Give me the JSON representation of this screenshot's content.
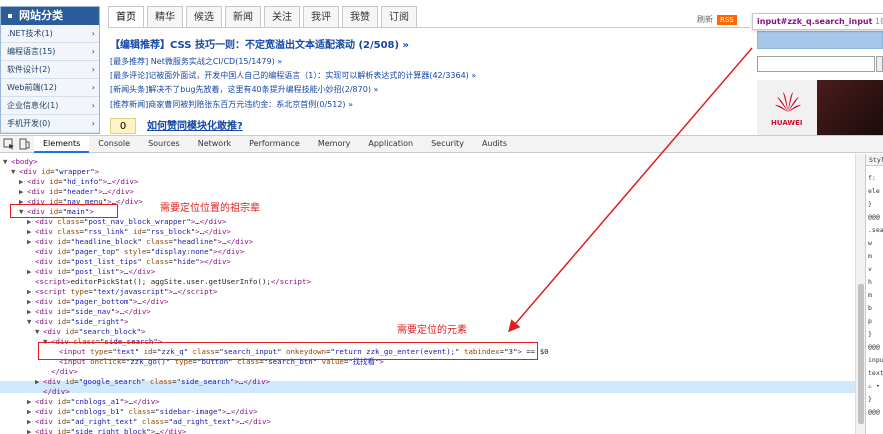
{
  "site": {
    "nav_header": "网站分类",
    "nav_items": [
      ".NET技术(1)",
      "编程语言(15)",
      "软件设计(2)",
      "Web前端(12)",
      "企业信息化(1)",
      "手机开发(0)"
    ],
    "tabs": [
      "首页",
      "精华",
      "候选",
      "新闻",
      "关注",
      "我评",
      "我赞",
      "订阅"
    ],
    "refresh": "刷新",
    "rss": "RSS",
    "headline": "【编辑推荐】CSS 技巧一则：不定宽溢出文本适配滚动 (2/508) »",
    "posts": [
      "[最多推荐] Net微服务实战之CI/CD(15/1479) »",
      "[最多评论]记被面外面试，开发中国人自己的编程语言（1）：实现可以解析表达式的计算器(42/3364) »",
      "[新闻头条]解决不了bug先放着，这里有40条提升编程技能小妙招(2/870) »",
      "[推荐新闻]商家曹同被判赔张东百万元违约金：系北京首例(0/512) »"
    ],
    "zero_badge": "0",
    "question": "如何赞同模块化敢推?",
    "tooltip": {
      "selector": "input#zzk_q.search_input",
      "size": "186 × 2"
    },
    "huawei": "HUAWEI"
  },
  "devtools": {
    "tabs": [
      "Elements",
      "Console",
      "Sources",
      "Network",
      "Performance",
      "Memory",
      "Application",
      "Security",
      "Audits"
    ],
    "styles_tab": "Styl",
    "styles_lines": [
      "f:",
      "ele",
      "}",
      "@@@",
      ".sea",
      "w",
      "m",
      "v",
      "h",
      "m",
      "b",
      "p",
      "}",
      "@@@",
      "inpu",
      "text",
      "⚠ •",
      "}",
      "@@@"
    ]
  },
  "dom": [
    {
      "d": 0,
      "tri": "",
      "html": "<span class='t'>&lt;html&gt;</span>"
    },
    {
      "d": 0,
      "tri": "▼",
      "html": "<span class='t'>&lt;body&gt;</span>"
    },
    {
      "d": 1,
      "tri": "▼",
      "html": "<span class='t'>&lt;div</span> <span class='an'>id</span>=\"<span class='av'>wrapper</span>\"<span class='t'>&gt;</span>"
    },
    {
      "d": 2,
      "tri": "▶",
      "html": "<span class='t'>&lt;div</span> <span class='an'>id</span>=\"<span class='av'>hd_info</span>\"<span class='t'>&gt;</span>…<span class='t'>&lt;/div&gt;</span>"
    },
    {
      "d": 2,
      "tri": "▶",
      "html": "<span class='t'>&lt;div</span> <span class='an'>id</span>=\"<span class='av'>header</span>\"<span class='t'>&gt;</span>…<span class='t'>&lt;/div&gt;</span>"
    },
    {
      "d": 2,
      "tri": "▶",
      "html": "<span class='t'>&lt;div</span> <span class='an'>id</span>=\"<span class='av'>nav_menu</span>\"<span class='t'>&gt;</span>…<span class='t'>&lt;/div&gt;</span>"
    },
    {
      "d": 2,
      "tri": "▼",
      "html": "<span class='t'>&lt;div</span> <span class='an'>id</span>=\"<span class='av'>main</span>\"<span class='t'>&gt;</span>"
    },
    {
      "d": 3,
      "tri": "▶",
      "html": "<span class='t'>&lt;div</span> <span class='an'>class</span>=\"<span class='av'>post_nav_block_wrapper</span>\"<span class='t'>&gt;</span>…<span class='t'>&lt;/div&gt;</span>"
    },
    {
      "d": 3,
      "tri": "▶",
      "html": "<span class='t'>&lt;div</span> <span class='an'>class</span>=\"<span class='av'>rss_link</span>\" <span class='an'>id</span>=\"<span class='av'>rss_block</span>\"<span class='t'>&gt;</span>…<span class='t'>&lt;/div&gt;</span>"
    },
    {
      "d": 3,
      "tri": "▶",
      "html": "<span class='t'>&lt;div</span> <span class='an'>id</span>=\"<span class='av'>headline_block</span>\" <span class='an'>class</span>=\"<span class='av'>headline</span>\"<span class='t'>&gt;</span>…<span class='t'>&lt;/div&gt;</span>"
    },
    {
      "d": 3,
      "tri": "",
      "html": "<span class='t'>&lt;div</span> <span class='an'>id</span>=\"<span class='av'>pager_top</span>\" <span class='an'>style</span>=\"<span class='av'>display:none</span>\"<span class='t'>&gt;&lt;/div&gt;</span>"
    },
    {
      "d": 3,
      "tri": "",
      "html": "<span class='t'>&lt;div</span> <span class='an'>id</span>=\"<span class='av'>post_list_tips</span>\" <span class='an'>class</span>=\"<span class='av'>hide</span>\"<span class='t'>&gt;&lt;/div&gt;</span>"
    },
    {
      "d": 3,
      "tri": "▶",
      "html": "<span class='t'>&lt;div</span> <span class='an'>id</span>=\"<span class='av'>post_list</span>\"<span class='t'>&gt;</span>…<span class='t'>&lt;/div&gt;</span>"
    },
    {
      "d": 3,
      "tri": "",
      "html": "<span class='t'>&lt;script&gt;</span><span class='tx'>editorPickStat(); aggSite.user.getUserInfo();</span><span class='t'>&lt;/script&gt;</span>"
    },
    {
      "d": 3,
      "tri": "▶",
      "html": "<span class='t'>&lt;script</span> <span class='an'>type</span>=\"<span class='av'>text/javascript</span>\"<span class='t'>&gt;</span>…<span class='t'>&lt;/script&gt;</span>"
    },
    {
      "d": 3,
      "tri": "▶",
      "html": "<span class='t'>&lt;div</span> <span class='an'>id</span>=\"<span class='av'>pager_bottom</span>\"<span class='t'>&gt;</span>…<span class='t'>&lt;/div&gt;</span>"
    },
    {
      "d": 3,
      "tri": "▶",
      "html": "<span class='t'>&lt;div</span> <span class='an'>id</span>=\"<span class='av'>side_nav</span>\"<span class='t'>&gt;</span>…<span class='t'>&lt;/div&gt;</span>"
    },
    {
      "d": 3,
      "tri": "▼",
      "html": "<span class='t'>&lt;div</span> <span class='an'>id</span>=\"<span class='av'>side_right</span>\"<span class='t'>&gt;</span>"
    },
    {
      "d": 4,
      "tri": "▼",
      "html": "<span class='t'>&lt;div</span> <span class='an'>id</span>=\"<span class='av'>search_block</span>\"<span class='t'>&gt;</span>"
    },
    {
      "d": 5,
      "tri": "▼",
      "html": "<span class='t'>&lt;div</span> <span class='an'>class</span>=\"<span class='av'>side_search</span>\"<span class='t'>&gt;</span>"
    },
    {
      "d": 6,
      "tri": "",
      "html": "<span class='t'>&lt;input</span> <span class='an'>type</span>=\"<span class='av'>text</span>\" <span class='an'>id</span>=\"<span class='av'>zzk_q</span>\" <span class='an'>class</span>=\"<span class='av'>search_input</span>\" <span class='an'>onkeydown</span>=\"<span class='av'>return zzk_go_enter(event);</span>\" <span class='an'>tabindex</span>=\"<span class='av'>3</span>\"<span class='t'>&gt;</span> == $0"
    },
    {
      "d": 6,
      "tri": "",
      "html": "<span class='t'>&lt;input</span> <span class='an'>onclick</span>=\"<span class='av'>zzk_go()</span>\" <span class='an'>type</span>=\"<span class='av'>button</span>\" <span class='an'>class</span>=\"<span class='av'>search_btn</span>\" <span class='an'>value</span>=\"<span class='av'>找找看</span>\"<span class='t'>&gt;</span>"
    },
    {
      "d": 5,
      "tri": "",
      "html": "<span class='t'>&lt;/div&gt;</span>"
    },
    {
      "d": 4,
      "tri": "▶",
      "html": "<span class='t'>&lt;div</span> <span class='an'>id</span>=\"<span class='av'>google_search</span>\" <span class='an'>class</span>=\"<span class='av'>side_search</span>\"<span class='t'>&gt;</span>…<span class='t'>&lt;/div&gt;</span>"
    },
    {
      "d": 4,
      "tri": "",
      "html": "<span class='t'>&lt;/div&gt;</span>"
    },
    {
      "d": 3,
      "tri": "▶",
      "html": "<span class='t'>&lt;div</span> <span class='an'>id</span>=\"<span class='av'>cnblogs_a1</span>\"<span class='t'>&gt;</span>…<span class='t'>&lt;/div&gt;</span>"
    },
    {
      "d": 3,
      "tri": "▶",
      "html": "<span class='t'>&lt;div</span> <span class='an'>id</span>=\"<span class='av'>cnblogs_b1</span>\" <span class='an'>class</span>=\"<span class='av'>sidebar-image</span>\"<span class='t'>&gt;</span>…<span class='t'>&lt;/div&gt;</span>"
    },
    {
      "d": 3,
      "tri": "▶",
      "html": "<span class='t'>&lt;div</span> <span class='an'>id</span>=\"<span class='av'>ad_right_text</span>\" <span class='an'>class</span>=\"<span class='av'>ad_right_text</span>\"<span class='t'>&gt;</span>…<span class='t'>&lt;/div&gt;</span>"
    },
    {
      "d": 3,
      "tri": "▶",
      "html": "<span class='t'>&lt;div</span> <span class='an'>id</span>=\"<span class='av'>side_right_block</span>\"<span class='t'>&gt;</span>…<span class='t'>&lt;/div&gt;</span>"
    }
  ],
  "annotations": {
    "ancestor": "需要定位位置的祖宗辈",
    "element": "需要定位的元素"
  },
  "colors": {
    "annotation": "#e02020",
    "selected_row": "#cfe8fc",
    "tag": "#881280",
    "attr_name": "#994500",
    "attr_value": "#1a1aa6"
  }
}
